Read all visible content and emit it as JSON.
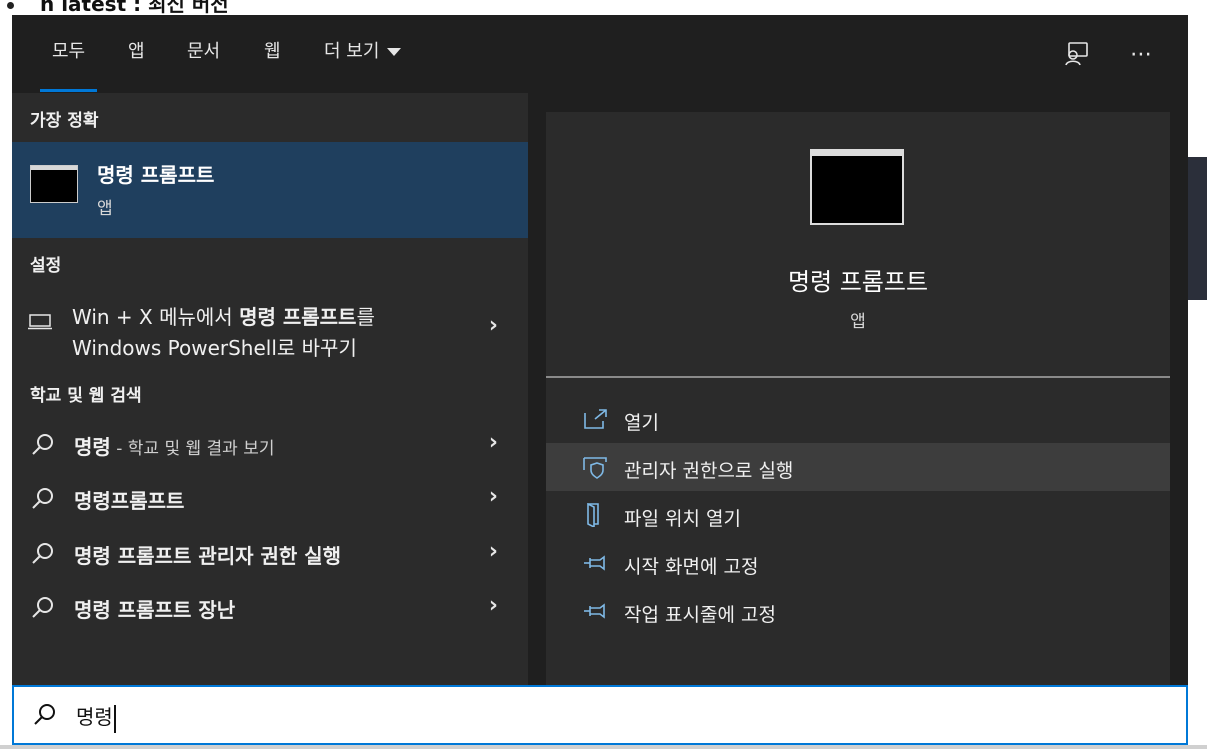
{
  "background": {
    "heading_text": "n latest : 최신 버전"
  },
  "tabs": [
    {
      "label": "모두",
      "active": true
    },
    {
      "label": "앱"
    },
    {
      "label": "문서"
    },
    {
      "label": "웹"
    },
    {
      "label": "더 보기"
    }
  ],
  "topbar": {
    "more_icon": "⋯"
  },
  "left": {
    "best_match_heading": "가장 정확",
    "best_match": {
      "title": "명령 프롬프트",
      "subtitle": "앱"
    },
    "settings_heading": "설정",
    "settings_item": {
      "line1_normal": "Win + X 메뉴에서 ",
      "line1_bold": "명령 프롬프트",
      "line1_tail": "를",
      "line2": "Windows PowerShell로 바꾸기"
    },
    "web_heading": "학교 및 웹 검색",
    "web_items": [
      {
        "bold": "명령",
        "muted": " - 학교 및 웹 결과 보기"
      },
      {
        "bold": "명령프롬프트",
        "muted": ""
      },
      {
        "bold": "명령 프롬프트 관리자 권한 실행",
        "muted": ""
      },
      {
        "bold": "명령 프롬프트 장난",
        "muted": ""
      }
    ]
  },
  "right": {
    "app_title": "명령 프롬프트",
    "app_subtitle": "앱",
    "actions": [
      {
        "label": "열기",
        "icon": "open-icon"
      },
      {
        "label": "관리자 권한으로 실행",
        "icon": "shield-icon"
      },
      {
        "label": "파일 위치 열기",
        "icon": "file-location-icon"
      },
      {
        "label": "시작 화면에 고정",
        "icon": "pin-icon"
      },
      {
        "label": "작업 표시줄에 고정",
        "icon": "pin-icon"
      }
    ]
  },
  "search": {
    "value": "명령"
  },
  "colors": {
    "accent": "#0078d7",
    "selected": "#1f3f5e",
    "panel": "#1f1f1f",
    "pane": "#2b2b2b",
    "icon_blue": "#7fb9e6"
  }
}
